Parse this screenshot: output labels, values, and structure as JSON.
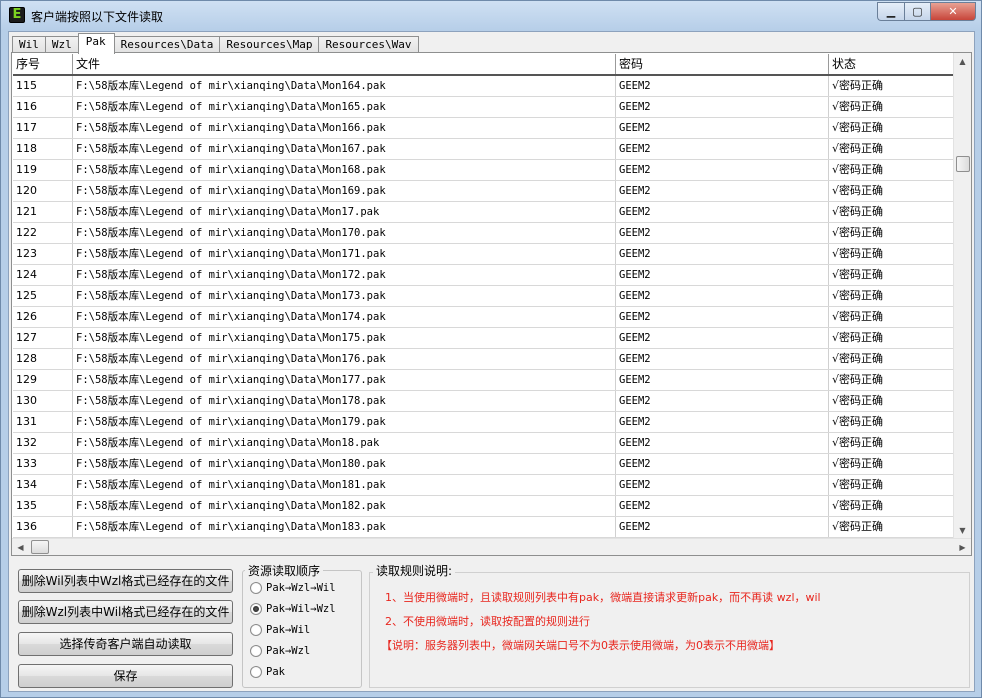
{
  "window": {
    "title": "客户端按照以下文件读取",
    "icon_letter": "E",
    "controls": {
      "minimize": "▁",
      "maximize": "▢",
      "close": "✕"
    }
  },
  "tabs": [
    {
      "label": "Wil",
      "active": false
    },
    {
      "label": "Wzl",
      "active": false
    },
    {
      "label": "Pak",
      "active": true
    },
    {
      "label": "Resources\\Data",
      "active": false
    },
    {
      "label": "Resources\\Map",
      "active": false
    },
    {
      "label": "Resources\\Wav",
      "active": false
    }
  ],
  "table": {
    "columns": [
      "序号",
      "文件",
      "密码",
      "状态"
    ],
    "rows": [
      {
        "seq": "115",
        "file": "F:\\58版本库\\Legend of mir\\xianqing\\Data\\Mon164.pak",
        "pwd": "GEEM2",
        "status": "√密码正确"
      },
      {
        "seq": "116",
        "file": "F:\\58版本库\\Legend of mir\\xianqing\\Data\\Mon165.pak",
        "pwd": "GEEM2",
        "status": "√密码正确"
      },
      {
        "seq": "117",
        "file": "F:\\58版本库\\Legend of mir\\xianqing\\Data\\Mon166.pak",
        "pwd": "GEEM2",
        "status": "√密码正确"
      },
      {
        "seq": "118",
        "file": "F:\\58版本库\\Legend of mir\\xianqing\\Data\\Mon167.pak",
        "pwd": "GEEM2",
        "status": "√密码正确"
      },
      {
        "seq": "119",
        "file": "F:\\58版本库\\Legend of mir\\xianqing\\Data\\Mon168.pak",
        "pwd": "GEEM2",
        "status": "√密码正确"
      },
      {
        "seq": "120",
        "file": "F:\\58版本库\\Legend of mir\\xianqing\\Data\\Mon169.pak",
        "pwd": "GEEM2",
        "status": "√密码正确"
      },
      {
        "seq": "121",
        "file": "F:\\58版本库\\Legend of mir\\xianqing\\Data\\Mon17.pak",
        "pwd": "GEEM2",
        "status": "√密码正确"
      },
      {
        "seq": "122",
        "file": "F:\\58版本库\\Legend of mir\\xianqing\\Data\\Mon170.pak",
        "pwd": "GEEM2",
        "status": "√密码正确"
      },
      {
        "seq": "123",
        "file": "F:\\58版本库\\Legend of mir\\xianqing\\Data\\Mon171.pak",
        "pwd": "GEEM2",
        "status": "√密码正确"
      },
      {
        "seq": "124",
        "file": "F:\\58版本库\\Legend of mir\\xianqing\\Data\\Mon172.pak",
        "pwd": "GEEM2",
        "status": "√密码正确"
      },
      {
        "seq": "125",
        "file": "F:\\58版本库\\Legend of mir\\xianqing\\Data\\Mon173.pak",
        "pwd": "GEEM2",
        "status": "√密码正确"
      },
      {
        "seq": "126",
        "file": "F:\\58版本库\\Legend of mir\\xianqing\\Data\\Mon174.pak",
        "pwd": "GEEM2",
        "status": "√密码正确"
      },
      {
        "seq": "127",
        "file": "F:\\58版本库\\Legend of mir\\xianqing\\Data\\Mon175.pak",
        "pwd": "GEEM2",
        "status": "√密码正确"
      },
      {
        "seq": "128",
        "file": "F:\\58版本库\\Legend of mir\\xianqing\\Data\\Mon176.pak",
        "pwd": "GEEM2",
        "status": "√密码正确"
      },
      {
        "seq": "129",
        "file": "F:\\58版本库\\Legend of mir\\xianqing\\Data\\Mon177.pak",
        "pwd": "GEEM2",
        "status": "√密码正确"
      },
      {
        "seq": "130",
        "file": "F:\\58版本库\\Legend of mir\\xianqing\\Data\\Mon178.pak",
        "pwd": "GEEM2",
        "status": "√密码正确"
      },
      {
        "seq": "131",
        "file": "F:\\58版本库\\Legend of mir\\xianqing\\Data\\Mon179.pak",
        "pwd": "GEEM2",
        "status": "√密码正确"
      },
      {
        "seq": "132",
        "file": "F:\\58版本库\\Legend of mir\\xianqing\\Data\\Mon18.pak",
        "pwd": "GEEM2",
        "status": "√密码正确"
      },
      {
        "seq": "133",
        "file": "F:\\58版本库\\Legend of mir\\xianqing\\Data\\Mon180.pak",
        "pwd": "GEEM2",
        "status": "√密码正确"
      },
      {
        "seq": "134",
        "file": "F:\\58版本库\\Legend of mir\\xianqing\\Data\\Mon181.pak",
        "pwd": "GEEM2",
        "status": "√密码正确"
      },
      {
        "seq": "135",
        "file": "F:\\58版本库\\Legend of mir\\xianqing\\Data\\Mon182.pak",
        "pwd": "GEEM2",
        "status": "√密码正确"
      },
      {
        "seq": "136",
        "file": "F:\\58版本库\\Legend of mir\\xianqing\\Data\\Mon183.pak",
        "pwd": "GEEM2",
        "status": "√密码正确"
      }
    ]
  },
  "scrollbars": {
    "up": "▲",
    "down": "▼",
    "left": "◀",
    "right": "▶"
  },
  "buttons": {
    "delete_wil": "删除Wil列表中Wzl格式已经存在的文件",
    "delete_wzl": "删除Wzl列表中Wil格式已经存在的文件",
    "select_client": "选择传奇客户端自动读取",
    "save": "保存"
  },
  "order_group": {
    "title": "资源读取顺序",
    "options": [
      {
        "label": "Pak→Wzl→Wil",
        "checked": false
      },
      {
        "label": "Pak→Wil→Wzl",
        "checked": true
      },
      {
        "label": "Pak→Wil",
        "checked": false
      },
      {
        "label": "Pak→Wzl",
        "checked": false
      },
      {
        "label": "Pak",
        "checked": false
      }
    ]
  },
  "rules": {
    "title": "读取规则说明:",
    "line1": "1、当使用微端时，且读取规则列表中有pak，微端直接请求更新pak，而不再读 wzl，wil",
    "line2": "2、不使用微端时，读取按配置的规则进行",
    "line3": "【说明：服务器列表中，微端网关端口号不为0表示使用微端，为0表示不用微端】",
    "color": "#e8261e"
  }
}
